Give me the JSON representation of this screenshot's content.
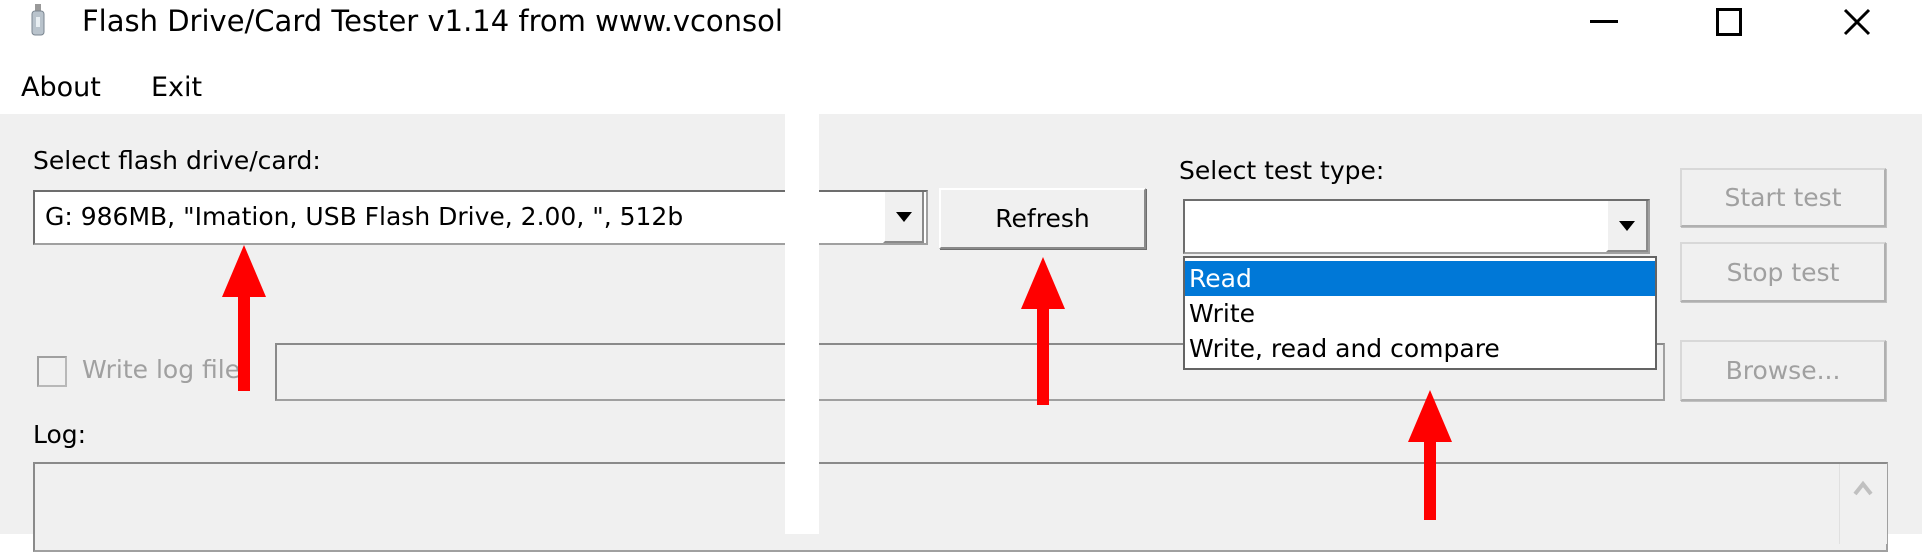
{
  "window": {
    "title": "Flash Drive/Card Tester v1.14 from www.vconsol",
    "icon": "usb-drive-icon",
    "controls": {
      "minimize": "minimize-icon",
      "maximize": "maximize-icon",
      "close": "close-icon"
    }
  },
  "menu": {
    "items": [
      {
        "label": "About"
      },
      {
        "label": "Exit"
      }
    ]
  },
  "drive": {
    "label": "Select flash drive/card:",
    "selected": "G: 986MB, \"Imation, USB Flash Drive, 2.00, \", 512b",
    "refresh_label": "Refresh"
  },
  "test": {
    "label": "Select test type:",
    "selected": "",
    "options": [
      "Read",
      "Write",
      "Write, read and compare"
    ],
    "highlighted": "Read"
  },
  "buttons": {
    "start": "Start test",
    "stop": "Stop test",
    "browse": "Browse..."
  },
  "logfile": {
    "checkbox_label": "Write log file",
    "checked": false,
    "path": ""
  },
  "log": {
    "label": "Log:",
    "content": ""
  },
  "annotation_color": "#ff0000",
  "highlight_color": "#0078d7"
}
